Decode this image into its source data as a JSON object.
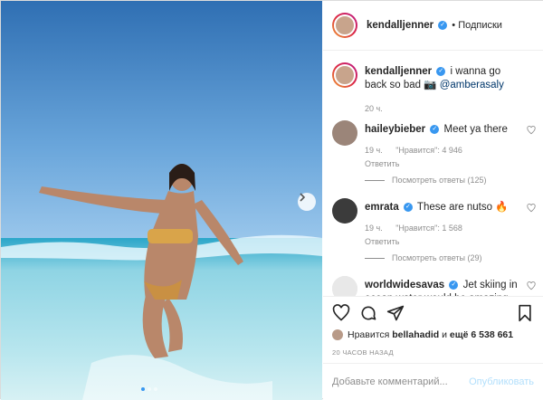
{
  "header": {
    "username": "kendalljenner",
    "separator": "•",
    "follow_label": "Подписки"
  },
  "caption": {
    "username": "kendalljenner",
    "text": "i wanna go back so bad 📷",
    "mention": "@amberasaly",
    "time": "20 ч."
  },
  "comments": [
    {
      "username": "haileybieber",
      "text": "Meet ya there",
      "time": "19 ч.",
      "likes": "\"Нравится\": 4 946",
      "reply": "Ответить",
      "view_replies": "Посмотреть ответы (125)"
    },
    {
      "username": "emrata",
      "text": "These are nutso 🔥",
      "time": "19 ч.",
      "likes": "\"Нравится\": 1 568",
      "reply": "Ответить",
      "view_replies": "Посмотреть ответы (29)"
    },
    {
      "username": "worldwidesavas",
      "text": "Jet skiing in ocean water would be amazing"
    }
  ],
  "likes_line": {
    "prefix": "Нравится",
    "user": "bellahadid",
    "middle": "и",
    "others": "ещё 6 538 661"
  },
  "post_time": "20 ЧАСОВ НАЗАД",
  "add_comment": {
    "placeholder": "Добавьте комментарий...",
    "publish_label": "Опубликовать"
  },
  "carousel": {
    "slide_count": 3,
    "active_slide": 1
  },
  "colors": {
    "accent": "#3897f0",
    "publish_disabled": "#b2dffc"
  }
}
